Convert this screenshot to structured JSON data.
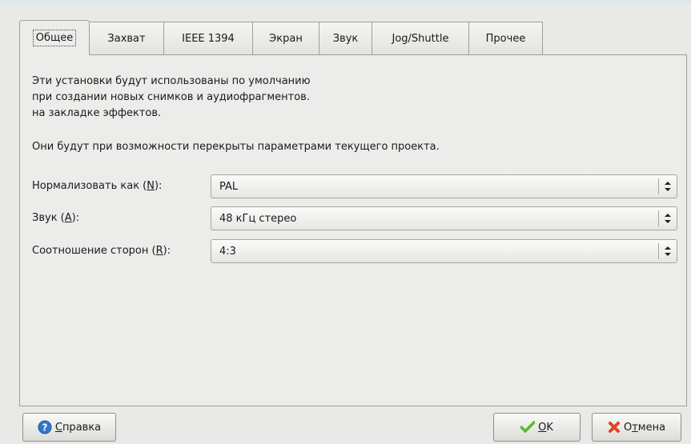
{
  "tabs": [
    {
      "label": "Общее"
    },
    {
      "label": "Захват"
    },
    {
      "label": "IEEE 1394"
    },
    {
      "label": "Экран"
    },
    {
      "label": "Звук"
    },
    {
      "label": "Jog/Shuttle"
    },
    {
      "label": "Прочее"
    }
  ],
  "general": {
    "description_lines": [
      "Эти установки будут использованы по умолчанию",
      "при создании новых снимков и аудиофрагментов.",
      "на закладке эффектов."
    ],
    "override_note": "Они будут при возможности перекрыты параметрами текущего проекта.",
    "fields": [
      {
        "label_pre": "Нормализовать как (",
        "mnemonic": "N",
        "label_post": "):",
        "value": "PAL"
      },
      {
        "label_pre": "Звук (",
        "mnemonic": "A",
        "label_post": "):",
        "value": "48 кГц стерео"
      },
      {
        "label_pre": "Соотношение сторон (",
        "mnemonic": "R",
        "label_post": "):",
        "value": "4:3"
      }
    ]
  },
  "buttons": {
    "help": {
      "mnemonic": "С",
      "rest": "правка",
      "icon": "help-icon"
    },
    "ok": {
      "mnemonic": "O",
      "rest": "K",
      "icon": "checkmark-icon"
    },
    "cancel": {
      "pre": "О",
      "mnemonic": "т",
      "rest": "мена",
      "icon": "cancel-icon"
    }
  },
  "colors": {
    "ok_icon": "#5cb82a",
    "cancel_icon": "#e0452a",
    "help_icon": "#2f78c8"
  }
}
